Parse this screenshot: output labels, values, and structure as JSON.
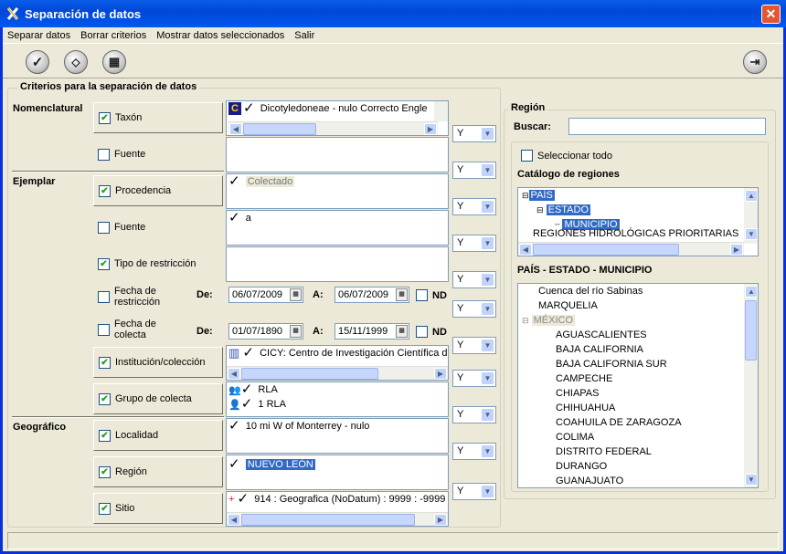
{
  "window": {
    "title": "Separación de datos",
    "close": "✕"
  },
  "menu": [
    "Separar datos",
    "Borrar criterios",
    "Mostrar datos seleccionados",
    "Salir"
  ],
  "criteria_group": {
    "title": "Criterios para la separación de datos"
  },
  "sections": {
    "nomenclatural": "Nomenclatural",
    "ejemplar": "Ejemplar",
    "geografico": "Geográfico"
  },
  "criteria": [
    {
      "label": "Taxón",
      "checked": true
    },
    {
      "label": "Fuente",
      "checked": false
    },
    {
      "label": "Procedencia",
      "checked": true
    },
    {
      "label": "Fuente",
      "checked": false
    },
    {
      "label": "Tipo de restricción",
      "checked": true
    },
    {
      "label": "Fecha de restricción",
      "checked": false
    },
    {
      "label": "Fecha de colecta",
      "checked": false
    },
    {
      "label": "Institución/colección",
      "checked": true
    },
    {
      "label": "Grupo de colecta",
      "checked": true
    },
    {
      "label": "Localidad",
      "checked": true
    },
    {
      "label": "Región",
      "checked": true
    },
    {
      "label": "Sitio",
      "checked": true
    }
  ],
  "values": {
    "taxon": "Dicotyledoneae - nulo  Correcto   Engle",
    "procedencia": "Colectado",
    "fuente": "a",
    "institucion": "CICY:  Centro de Investigación Científica d",
    "grupo1": "RLA",
    "grupo2": "1 RLA",
    "localidad": "10 mi W of Monterrey - nulo",
    "region": "NUEVO LEÓN",
    "sitio": "914 : Geografica (NoDatum) : 9999 : -9999"
  },
  "combos": [
    "Y",
    "Y",
    "Y",
    "Y",
    "Y",
    "Y",
    "Y",
    "Y",
    "Y",
    "Y",
    "Y",
    "Y"
  ],
  "dates": {
    "de_label": "De:",
    "a_label": "A:",
    "nd_label": "ND",
    "restriccion_de": "06/07/2009",
    "restriccion_a": "06/07/2009",
    "colecta_de": "01/07/1890",
    "colecta_a": "15/11/1999"
  },
  "region_panel": {
    "title": "Región",
    "search_label": "Buscar:",
    "search_value": "",
    "select_all": "Seleccionar todo",
    "catalog_title": "Catálogo de regiones",
    "catalog": [
      "PAÍS",
      "ESTADO",
      "MUNICIPIO",
      "REGIONES HIDROLÓGICAS PRIORITARIAS"
    ],
    "list_title": "PAÍS - ESTADO - MUNICIPIO",
    "list_top": [
      "Cuenca del río Sabinas",
      "MARQUELIA",
      "MÉXICO"
    ],
    "states": [
      "AGUASCALIENTES",
      "BAJA CALIFORNIA",
      "BAJA CALIFORNIA SUR",
      "CAMPECHE",
      "CHIAPAS",
      "CHIHUAHUA",
      "COAHUILA DE ZARAGOZA",
      "COLIMA",
      "DISTRITO FEDERAL",
      "DURANGO",
      "GUANAJUATO"
    ]
  },
  "colors": {
    "title_bar": "#0058ee",
    "selection": "#316ac5",
    "face": "#ece9d8"
  }
}
